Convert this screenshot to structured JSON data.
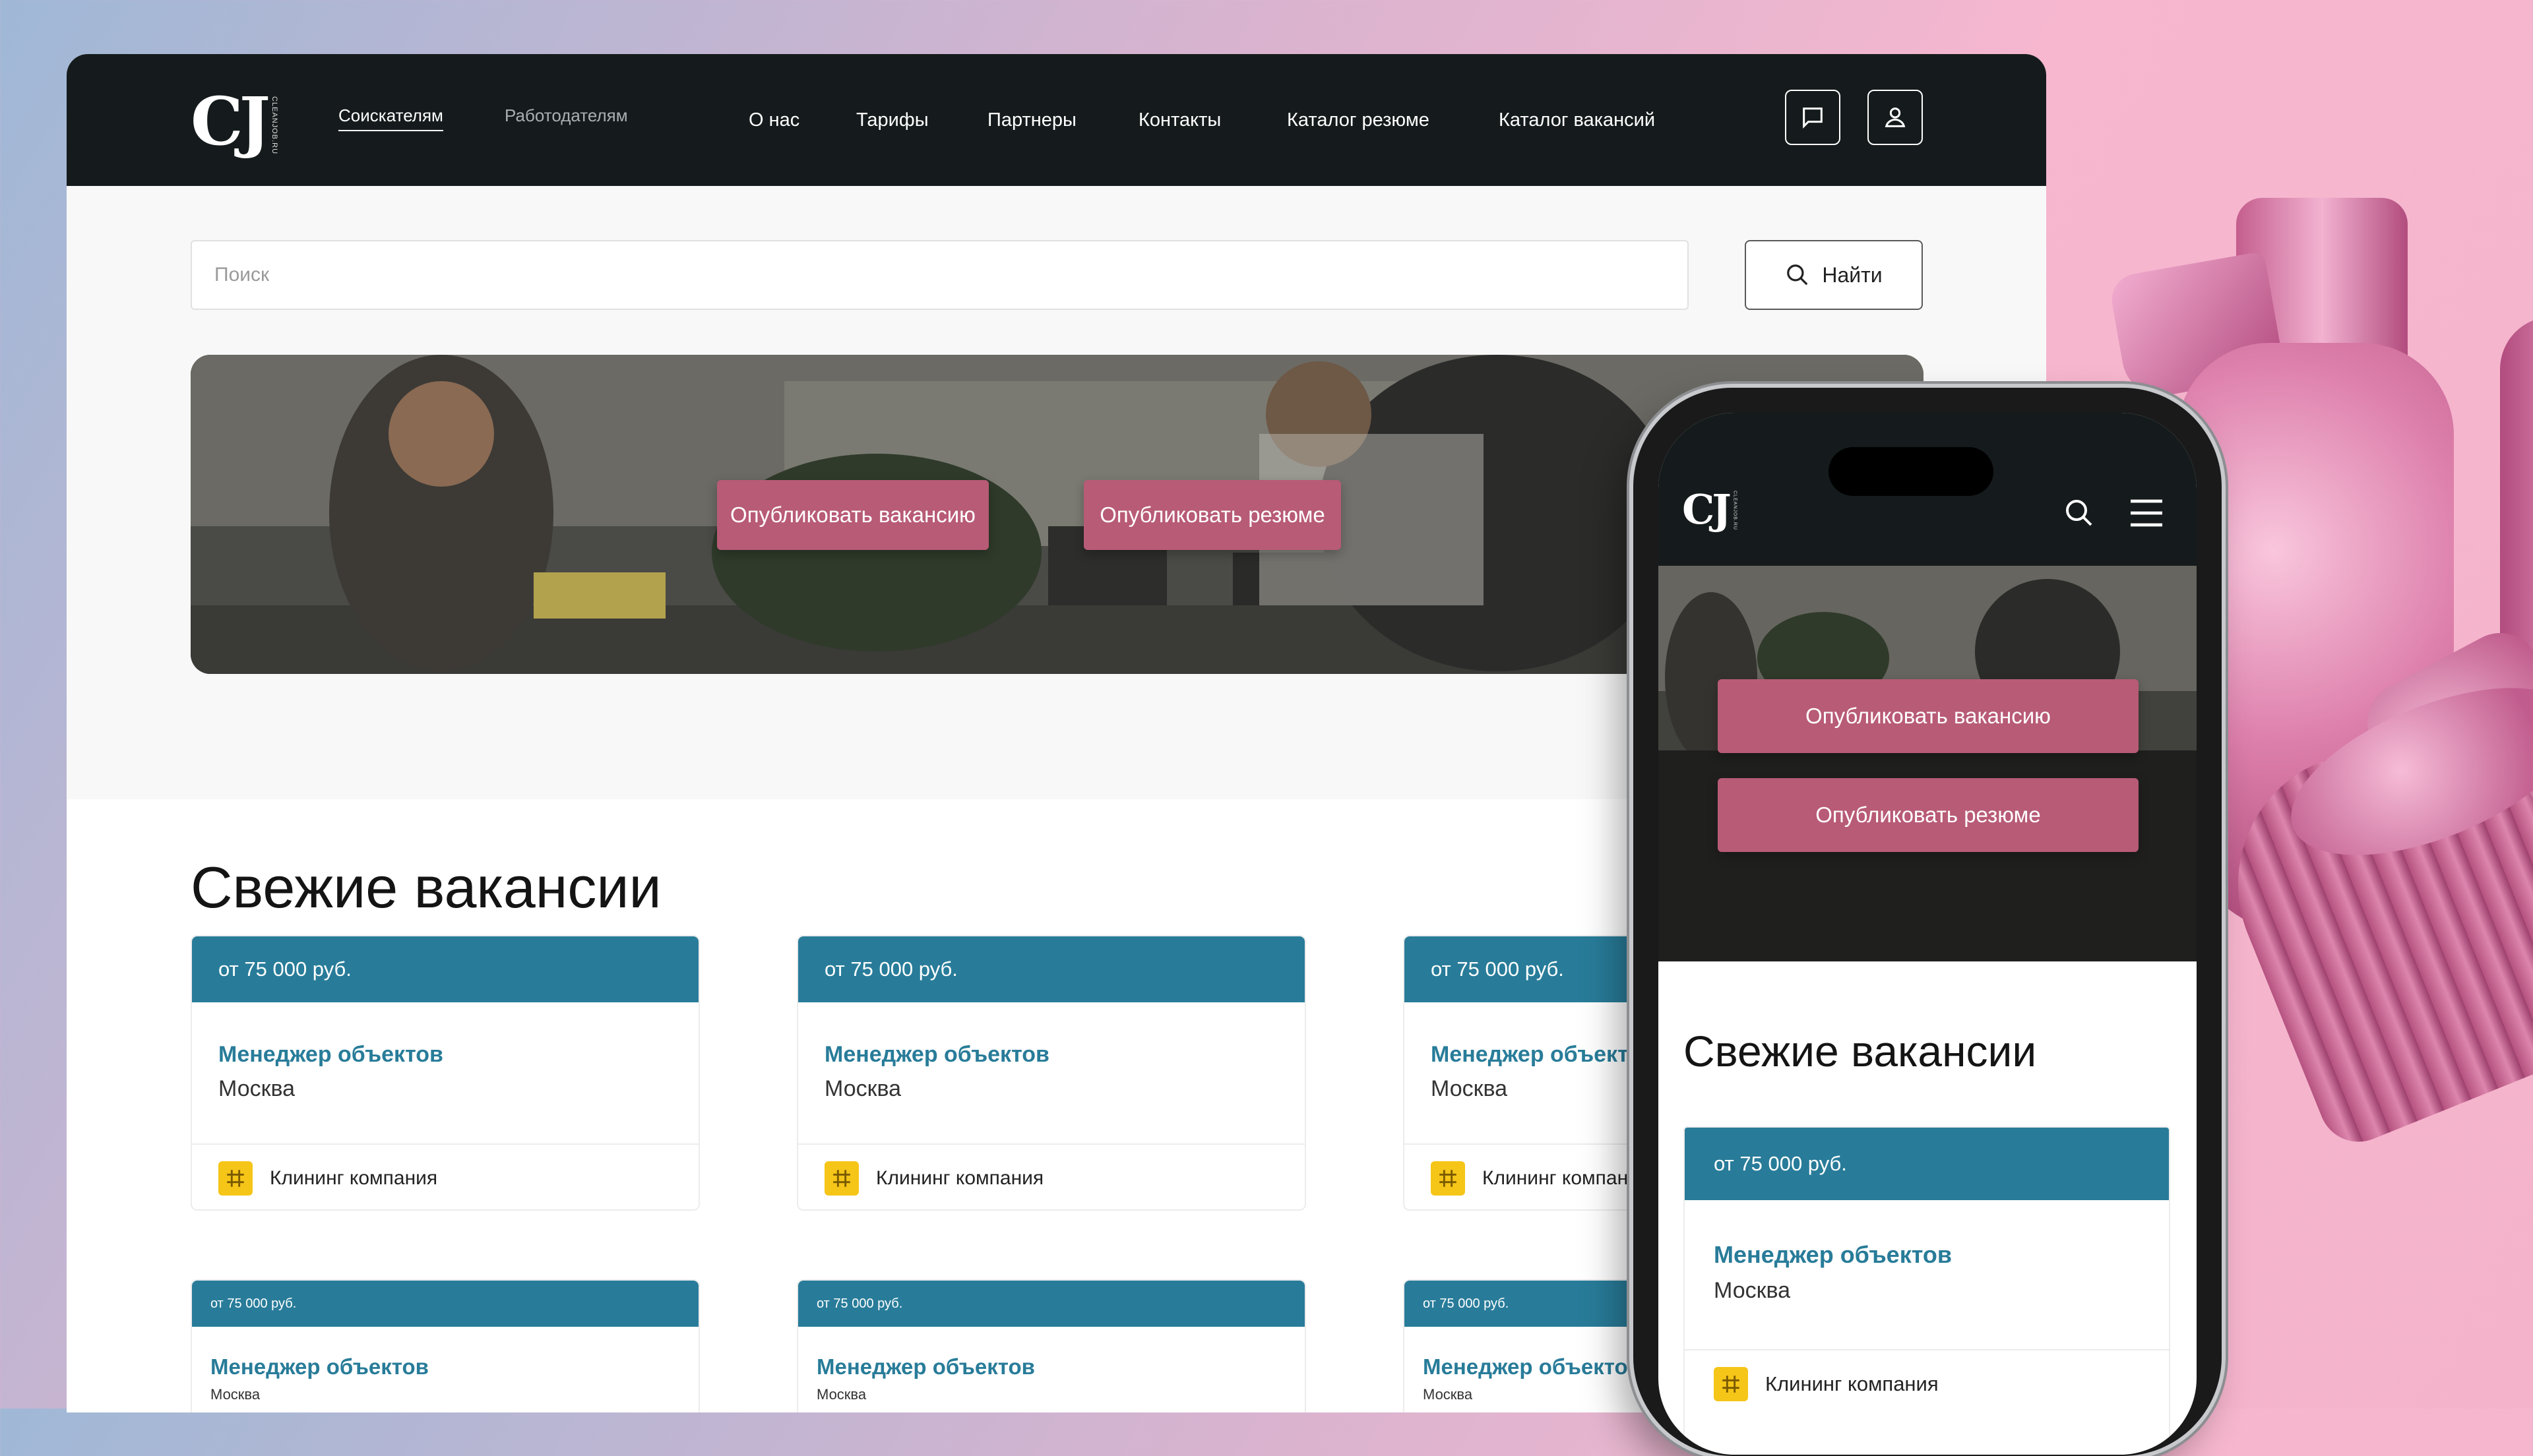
{
  "brand": {
    "logo": "CJ",
    "logo_sub": "CLEANJOB.RU"
  },
  "header": {
    "audience_tabs": [
      {
        "label": "Соискателям",
        "active": true
      },
      {
        "label": "Работодателям",
        "active": false
      }
    ],
    "nav": [
      "О нас",
      "Тарифы",
      "Партнеры",
      "Контакты",
      "Каталог резюме",
      "Каталог вакансий"
    ],
    "icons": [
      "chat-icon",
      "user-icon"
    ]
  },
  "search": {
    "placeholder": "Поиск",
    "button_label": "Найти",
    "icon": "search-icon"
  },
  "hero": {
    "publish_vacancy": "Опубликовать вакансию",
    "publish_resume": "Опубликовать резюме"
  },
  "section": {
    "title": "Свежие вакансии"
  },
  "vacancies": [
    {
      "salary": "от 75 000 руб.",
      "title": "Менеджер объектов",
      "city": "Москва",
      "company": "Клининг компания"
    },
    {
      "salary": "от 75 000 руб.",
      "title": "Менеджер объектов",
      "city": "Москва",
      "company": "Клининг компания"
    },
    {
      "salary": "от 75 000 руб.",
      "title": "Менеджер объектов",
      "city": "Москва",
      "company": "Клининг компания"
    }
  ],
  "vacancies_row2": [
    {
      "salary": "от 75 000 руб.",
      "title": "Менеджер объектов",
      "city": "Москва"
    },
    {
      "salary": "от 75 000 руб.",
      "title": "Менеджер объектов",
      "city": "Москва"
    },
    {
      "salary": "от 75 000 руб.",
      "title": "Менеджер объектов",
      "city": "Москва"
    }
  ],
  "mobile": {
    "logo": "CJ",
    "icons": [
      "search-icon",
      "menu-icon"
    ],
    "publish_vacancy": "Опубликовать вакансию",
    "publish_resume": "Опубликовать резюме",
    "section_title": "Свежие вакансии",
    "card": {
      "salary": "от 75 000 руб.",
      "title": "Менеджер объектов",
      "city": "Москва",
      "company": "Клининг компания"
    }
  },
  "colors": {
    "header_bg": "#151b1c",
    "accent_teal": "#287c99",
    "button_pink": "#b85b76",
    "company_logo": "#f5c518"
  }
}
